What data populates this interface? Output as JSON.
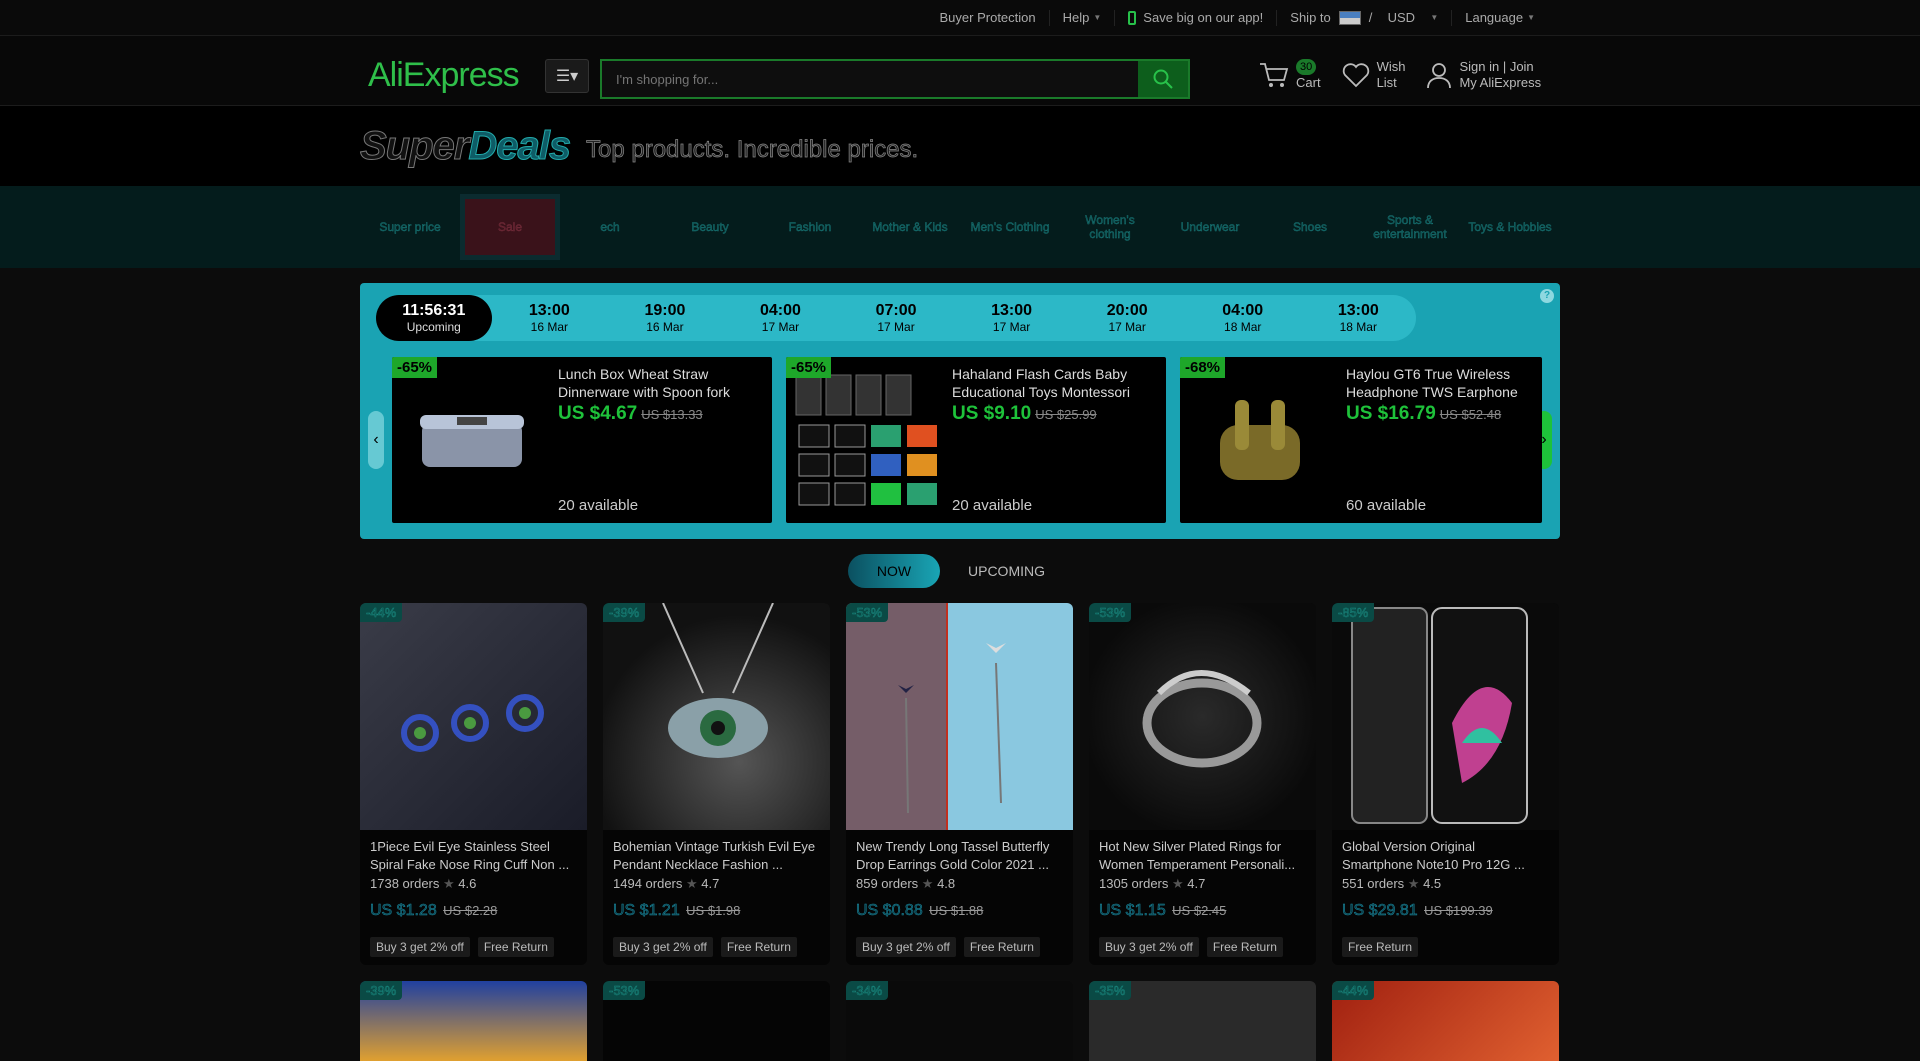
{
  "topbar": {
    "buyer_protection": "Buyer Protection",
    "help": "Help",
    "app": "Save big on our app!",
    "ship_to": "Ship to",
    "currency_sep": "/",
    "currency": "USD",
    "language": "Language"
  },
  "header": {
    "logo": "AliExpress",
    "search_placeholder": "I'm shopping for...",
    "cart_count": "30",
    "cart_label": "Cart",
    "wish_1": "Wish",
    "wish_2": "List",
    "sign_in": "Sign in",
    "join": "Join",
    "my_account": "My AliExpress"
  },
  "banner": {
    "super": "Super",
    "deals": "Deals",
    "tagline": "Top products. Incredible prices."
  },
  "categories": [
    "Super price",
    "Sale",
    "ech",
    "Beauty",
    "Fashion",
    "Mother & Kids",
    "Men's Clothing",
    "Women's clothing",
    "Underwear",
    "Shoes",
    "Sports & entertainment",
    "Toys & Hobbies"
  ],
  "flash": {
    "help": "?",
    "slots": [
      {
        "time": "11:56:31",
        "date": "Upcoming"
      },
      {
        "time": "13:00",
        "date": "16 Mar"
      },
      {
        "time": "19:00",
        "date": "16 Mar"
      },
      {
        "time": "04:00",
        "date": "17 Mar"
      },
      {
        "time": "07:00",
        "date": "17 Mar"
      },
      {
        "time": "13:00",
        "date": "17 Mar"
      },
      {
        "time": "20:00",
        "date": "17 Mar"
      },
      {
        "time": "04:00",
        "date": "18 Mar"
      },
      {
        "time": "13:00",
        "date": "18 Mar"
      }
    ],
    "cards": [
      {
        "discount": "-65%",
        "title": "Lunch Box Wheat Straw Dinnerware with Spoon fork",
        "price": "US $4.67",
        "old": "US $13.33",
        "available": "20 available"
      },
      {
        "discount": "-65%",
        "title": "Hahaland Flash Cards Baby Educational Toys Montessori",
        "price": "US $9.10",
        "old": "US $25.99",
        "available": "20 available"
      },
      {
        "discount": "-68%",
        "title": "Haylou GT6 True Wireless Headphone TWS Earphone",
        "price": "US $16.79",
        "old": "US $52.48",
        "available": "60 available"
      }
    ]
  },
  "toggle": {
    "now": "NOW",
    "upcoming": "UPCOMING"
  },
  "products": [
    {
      "badge": "-44%",
      "title": "1Piece Evil Eye Stainless Steel Spiral Fake Nose Ring Cuff Non ...",
      "orders": "1738 orders",
      "rating": "4.6",
      "price": "US $1.28",
      "old": "US $2.28",
      "tags": [
        "Buy 3 get 2% off",
        "Free Return"
      ]
    },
    {
      "badge": "-39%",
      "title": "Bohemian Vintage Turkish Evil Eye Pendant Necklace Fashion ...",
      "orders": "1494 orders",
      "rating": "4.7",
      "price": "US $1.21",
      "old": "US $1.98",
      "tags": [
        "Buy 3 get 2% off",
        "Free Return"
      ]
    },
    {
      "badge": "-53%",
      "title": "New Trendy Long Tassel Butterfly Drop Earrings Gold Color 2021 ...",
      "orders": "859 orders",
      "rating": "4.8",
      "price": "US $0.88",
      "old": "US $1.88",
      "tags": [
        "Buy 3 get 2% off",
        "Free Return"
      ]
    },
    {
      "badge": "-53%",
      "title": "Hot New Silver Plated Rings for Women Temperament Personali...",
      "orders": "1305 orders",
      "rating": "4.7",
      "price": "US $1.15",
      "old": "US $2.45",
      "tags": [
        "Buy 3 get 2% off",
        "Free Return"
      ]
    },
    {
      "badge": "-85%",
      "title": "Global Version Original Smartphone Note10 Pro 12G ...",
      "orders": "551 orders",
      "rating": "4.5",
      "price": "US $29.81",
      "old": "US $199.39",
      "tags": [
        "Free Return"
      ]
    }
  ],
  "products_row2": [
    {
      "badge": "-39%"
    },
    {
      "badge": "-53%"
    },
    {
      "badge": "-34%"
    },
    {
      "badge": "-35%"
    },
    {
      "badge": "-44%"
    }
  ],
  "colors": {
    "accent_green": "#1ec23a",
    "flash_bg": "#1aa3b3",
    "catnav_bg": "#041c1c"
  }
}
